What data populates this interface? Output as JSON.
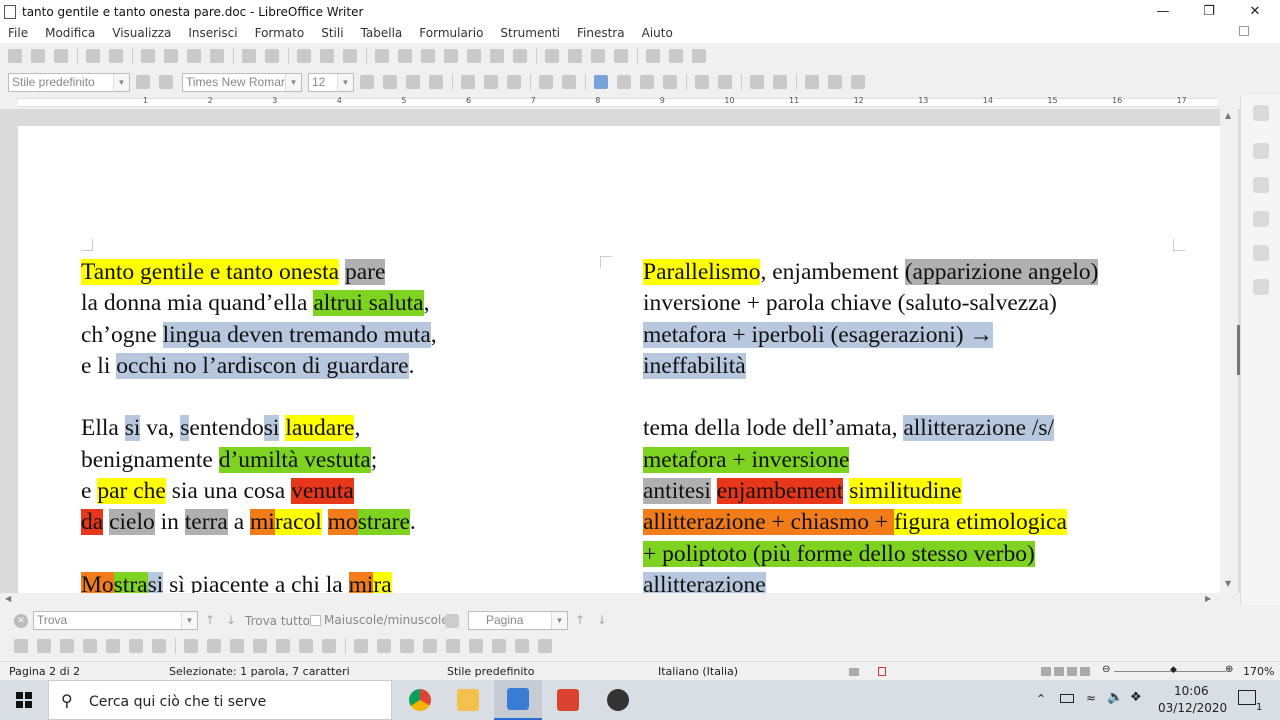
{
  "window": {
    "title": "tanto gentile e tanto onesta pare.doc - LibreOffice Writer"
  },
  "menu": [
    "File",
    "Modifica",
    "Visualizza",
    "Inserisci",
    "Formato",
    "Stili",
    "Tabella",
    "Formulario",
    "Strumenti",
    "Finestra",
    "Aiuto"
  ],
  "format_bar": {
    "paragraph_style": "Stile predefinito",
    "font_name": "Times New Roman",
    "font_size": "12"
  },
  "ruler_numbers": [
    "1",
    "2",
    "3",
    "4",
    "5",
    "6",
    "7",
    "8",
    "9",
    "10",
    "11",
    "12",
    "13",
    "14",
    "15",
    "16",
    "17"
  ],
  "document": {
    "left_column": [
      [
        {
          "t": "Tanto gentile e tanto onesta",
          "h": "hy"
        },
        {
          "t": " ",
          "h": ""
        },
        {
          "t": "pare",
          "h": "hgr"
        }
      ],
      [
        {
          "t": "la donna mia quand’ella ",
          "h": ""
        },
        {
          "t": "altrui saluta",
          "h": "hg"
        },
        {
          "t": ",",
          "h": ""
        }
      ],
      [
        {
          "t": "ch’ogne ",
          "h": ""
        },
        {
          "t": "lingua deven tremando muta",
          "h": "hb"
        },
        {
          "t": ",",
          "h": ""
        }
      ],
      [
        {
          "t": "e li ",
          "h": ""
        },
        {
          "t": "occhi no l’ardiscon di guardare",
          "h": "hb"
        },
        {
          "t": ".",
          "h": ""
        }
      ],
      [],
      [
        {
          "t": "Ella ",
          "h": ""
        },
        {
          "t": "si",
          "h": "hb"
        },
        {
          "t": " va, ",
          "h": ""
        },
        {
          "t": "s",
          "h": "hb"
        },
        {
          "t": "entendo",
          "h": ""
        },
        {
          "t": "si",
          "h": "hb"
        },
        {
          "t": " ",
          "h": ""
        },
        {
          "t": "laudare",
          "h": "hy"
        },
        {
          "t": ",",
          "h": ""
        }
      ],
      [
        {
          "t": "benignamente ",
          "h": ""
        },
        {
          "t": "d’umiltà vestuta",
          "h": "hg"
        },
        {
          "t": ";",
          "h": ""
        }
      ],
      [
        {
          "t": "e ",
          "h": ""
        },
        {
          "t": "par che",
          "h": "hy"
        },
        {
          "t": " sia una cosa ",
          "h": ""
        },
        {
          "t": "venuta",
          "h": "hr"
        }
      ],
      [
        {
          "t": "da",
          "h": "hr"
        },
        {
          "t": " ",
          "h": ""
        },
        {
          "t": "cielo",
          "h": "hgr"
        },
        {
          "t": " in ",
          "h": ""
        },
        {
          "t": "terra",
          "h": "hgr"
        },
        {
          "t": " a ",
          "h": ""
        },
        {
          "t": "mi",
          "h": "ho"
        },
        {
          "t": "racol",
          "h": "hy"
        },
        {
          "t": " ",
          "h": ""
        },
        {
          "t": "mo",
          "h": "ho"
        },
        {
          "t": "strare",
          "h": "hg"
        },
        {
          "t": ".",
          "h": ""
        }
      ],
      [],
      [
        {
          "t": "Mo",
          "h": "ho"
        },
        {
          "t": "stra",
          "h": "hg"
        },
        {
          "t": "si",
          "h": "hb"
        },
        {
          "t": " sì piacente a chi la ",
          "h": ""
        },
        {
          "t": "mi",
          "h": "ho"
        },
        {
          "t": "ra",
          "h": "hy"
        }
      ]
    ],
    "right_column": [
      [
        {
          "t": "Parallelismo",
          "h": "hy"
        },
        {
          "t": ", enjambement ",
          "h": ""
        },
        {
          "t": "(apparizione angelo)",
          "h": "hgr"
        }
      ],
      [
        {
          "t": "inversione + parola chiave (saluto-salvezza)",
          "h": ""
        }
      ],
      [
        {
          "t": "metafora + iperboli (esagerazioni) →",
          "h": "hb"
        }
      ],
      [
        {
          "t": "ineffabilità",
          "h": "hb"
        }
      ],
      [],
      [
        {
          "t": "tema della lode dell’amata, ",
          "h": ""
        },
        {
          "t": "allitterazione /s/",
          "h": "hb"
        }
      ],
      [
        {
          "t": "metafora + inversione",
          "h": "hg"
        }
      ],
      [
        {
          "t": "antitesi",
          "h": "hgr"
        },
        {
          "t": " ",
          "h": ""
        },
        {
          "t": "enjambement",
          "h": "hr"
        },
        {
          "t": " ",
          "h": ""
        },
        {
          "t": "similitudine",
          "h": "hy"
        }
      ],
      [
        {
          "t": "allitterazione + chiasmo + ",
          "h": "ho"
        },
        {
          "t": "figura etimologica",
          "h": "hy"
        }
      ],
      [
        {
          "t": "+ poliptoto (più forme dello stesso verbo)",
          "h": "hg"
        }
      ],
      [
        {
          "t": "allitterazione",
          "h": "hb"
        }
      ]
    ]
  },
  "find_bar": {
    "search_placeholder": "Trova",
    "find_all": "Trova tutto",
    "match_case": "Maiuscole/minuscole",
    "nav_type": "Pagina"
  },
  "status_bar": {
    "page": "Pagina 2 di 2",
    "selection": "Selezionate: 1 parola, 7 caratteri",
    "style": "Stile predefinito",
    "language": "Italiano (Italia)",
    "zoom": "170%"
  },
  "taskbar": {
    "search_text": "Cerca qui ciò che ti serve",
    "time": "10:06",
    "date": "03/12/2020",
    "notification_count": "1"
  },
  "colors": {
    "yellow": "#ffff00",
    "green": "#7ed321",
    "gray": "#b0b0b0",
    "blue": "#b7c7dd",
    "red": "#e8361b",
    "orange": "#f37c1a"
  }
}
